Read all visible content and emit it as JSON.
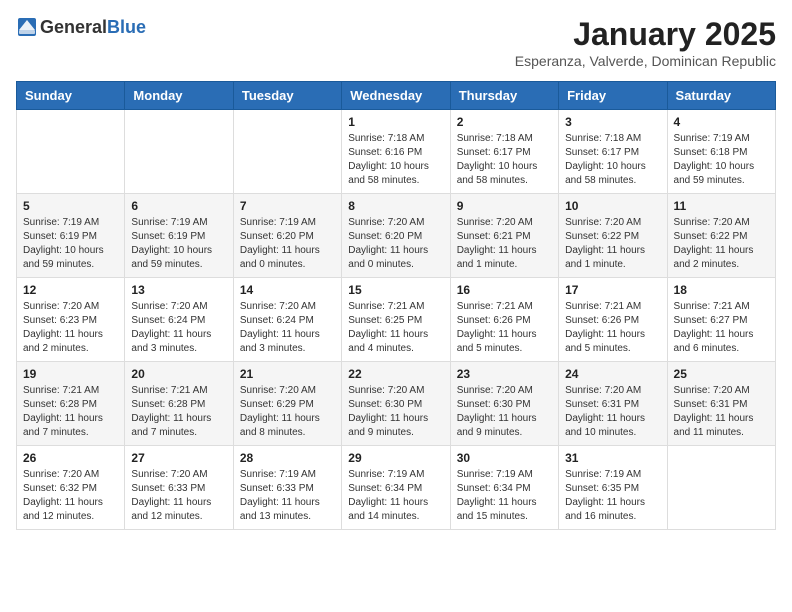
{
  "header": {
    "logo_general": "General",
    "logo_blue": "Blue",
    "month_year": "January 2025",
    "location": "Esperanza, Valverde, Dominican Republic"
  },
  "calendar": {
    "days_of_week": [
      "Sunday",
      "Monday",
      "Tuesday",
      "Wednesday",
      "Thursday",
      "Friday",
      "Saturday"
    ],
    "weeks": [
      [
        {
          "day": "",
          "info": ""
        },
        {
          "day": "",
          "info": ""
        },
        {
          "day": "",
          "info": ""
        },
        {
          "day": "1",
          "info": "Sunrise: 7:18 AM\nSunset: 6:16 PM\nDaylight: 10 hours\nand 58 minutes."
        },
        {
          "day": "2",
          "info": "Sunrise: 7:18 AM\nSunset: 6:17 PM\nDaylight: 10 hours\nand 58 minutes."
        },
        {
          "day": "3",
          "info": "Sunrise: 7:18 AM\nSunset: 6:17 PM\nDaylight: 10 hours\nand 58 minutes."
        },
        {
          "day": "4",
          "info": "Sunrise: 7:19 AM\nSunset: 6:18 PM\nDaylight: 10 hours\nand 59 minutes."
        }
      ],
      [
        {
          "day": "5",
          "info": "Sunrise: 7:19 AM\nSunset: 6:19 PM\nDaylight: 10 hours\nand 59 minutes."
        },
        {
          "day": "6",
          "info": "Sunrise: 7:19 AM\nSunset: 6:19 PM\nDaylight: 10 hours\nand 59 minutes."
        },
        {
          "day": "7",
          "info": "Sunrise: 7:19 AM\nSunset: 6:20 PM\nDaylight: 11 hours\nand 0 minutes."
        },
        {
          "day": "8",
          "info": "Sunrise: 7:20 AM\nSunset: 6:20 PM\nDaylight: 11 hours\nand 0 minutes."
        },
        {
          "day": "9",
          "info": "Sunrise: 7:20 AM\nSunset: 6:21 PM\nDaylight: 11 hours\nand 1 minute."
        },
        {
          "day": "10",
          "info": "Sunrise: 7:20 AM\nSunset: 6:22 PM\nDaylight: 11 hours\nand 1 minute."
        },
        {
          "day": "11",
          "info": "Sunrise: 7:20 AM\nSunset: 6:22 PM\nDaylight: 11 hours\nand 2 minutes."
        }
      ],
      [
        {
          "day": "12",
          "info": "Sunrise: 7:20 AM\nSunset: 6:23 PM\nDaylight: 11 hours\nand 2 minutes."
        },
        {
          "day": "13",
          "info": "Sunrise: 7:20 AM\nSunset: 6:24 PM\nDaylight: 11 hours\nand 3 minutes."
        },
        {
          "day": "14",
          "info": "Sunrise: 7:20 AM\nSunset: 6:24 PM\nDaylight: 11 hours\nand 3 minutes."
        },
        {
          "day": "15",
          "info": "Sunrise: 7:21 AM\nSunset: 6:25 PM\nDaylight: 11 hours\nand 4 minutes."
        },
        {
          "day": "16",
          "info": "Sunrise: 7:21 AM\nSunset: 6:26 PM\nDaylight: 11 hours\nand 5 minutes."
        },
        {
          "day": "17",
          "info": "Sunrise: 7:21 AM\nSunset: 6:26 PM\nDaylight: 11 hours\nand 5 minutes."
        },
        {
          "day": "18",
          "info": "Sunrise: 7:21 AM\nSunset: 6:27 PM\nDaylight: 11 hours\nand 6 minutes."
        }
      ],
      [
        {
          "day": "19",
          "info": "Sunrise: 7:21 AM\nSunset: 6:28 PM\nDaylight: 11 hours\nand 7 minutes."
        },
        {
          "day": "20",
          "info": "Sunrise: 7:21 AM\nSunset: 6:28 PM\nDaylight: 11 hours\nand 7 minutes."
        },
        {
          "day": "21",
          "info": "Sunrise: 7:20 AM\nSunset: 6:29 PM\nDaylight: 11 hours\nand 8 minutes."
        },
        {
          "day": "22",
          "info": "Sunrise: 7:20 AM\nSunset: 6:30 PM\nDaylight: 11 hours\nand 9 minutes."
        },
        {
          "day": "23",
          "info": "Sunrise: 7:20 AM\nSunset: 6:30 PM\nDaylight: 11 hours\nand 9 minutes."
        },
        {
          "day": "24",
          "info": "Sunrise: 7:20 AM\nSunset: 6:31 PM\nDaylight: 11 hours\nand 10 minutes."
        },
        {
          "day": "25",
          "info": "Sunrise: 7:20 AM\nSunset: 6:31 PM\nDaylight: 11 hours\nand 11 minutes."
        }
      ],
      [
        {
          "day": "26",
          "info": "Sunrise: 7:20 AM\nSunset: 6:32 PM\nDaylight: 11 hours\nand 12 minutes."
        },
        {
          "day": "27",
          "info": "Sunrise: 7:20 AM\nSunset: 6:33 PM\nDaylight: 11 hours\nand 12 minutes."
        },
        {
          "day": "28",
          "info": "Sunrise: 7:19 AM\nSunset: 6:33 PM\nDaylight: 11 hours\nand 13 minutes."
        },
        {
          "day": "29",
          "info": "Sunrise: 7:19 AM\nSunset: 6:34 PM\nDaylight: 11 hours\nand 14 minutes."
        },
        {
          "day": "30",
          "info": "Sunrise: 7:19 AM\nSunset: 6:34 PM\nDaylight: 11 hours\nand 15 minutes."
        },
        {
          "day": "31",
          "info": "Sunrise: 7:19 AM\nSunset: 6:35 PM\nDaylight: 11 hours\nand 16 minutes."
        },
        {
          "day": "",
          "info": ""
        }
      ]
    ]
  }
}
